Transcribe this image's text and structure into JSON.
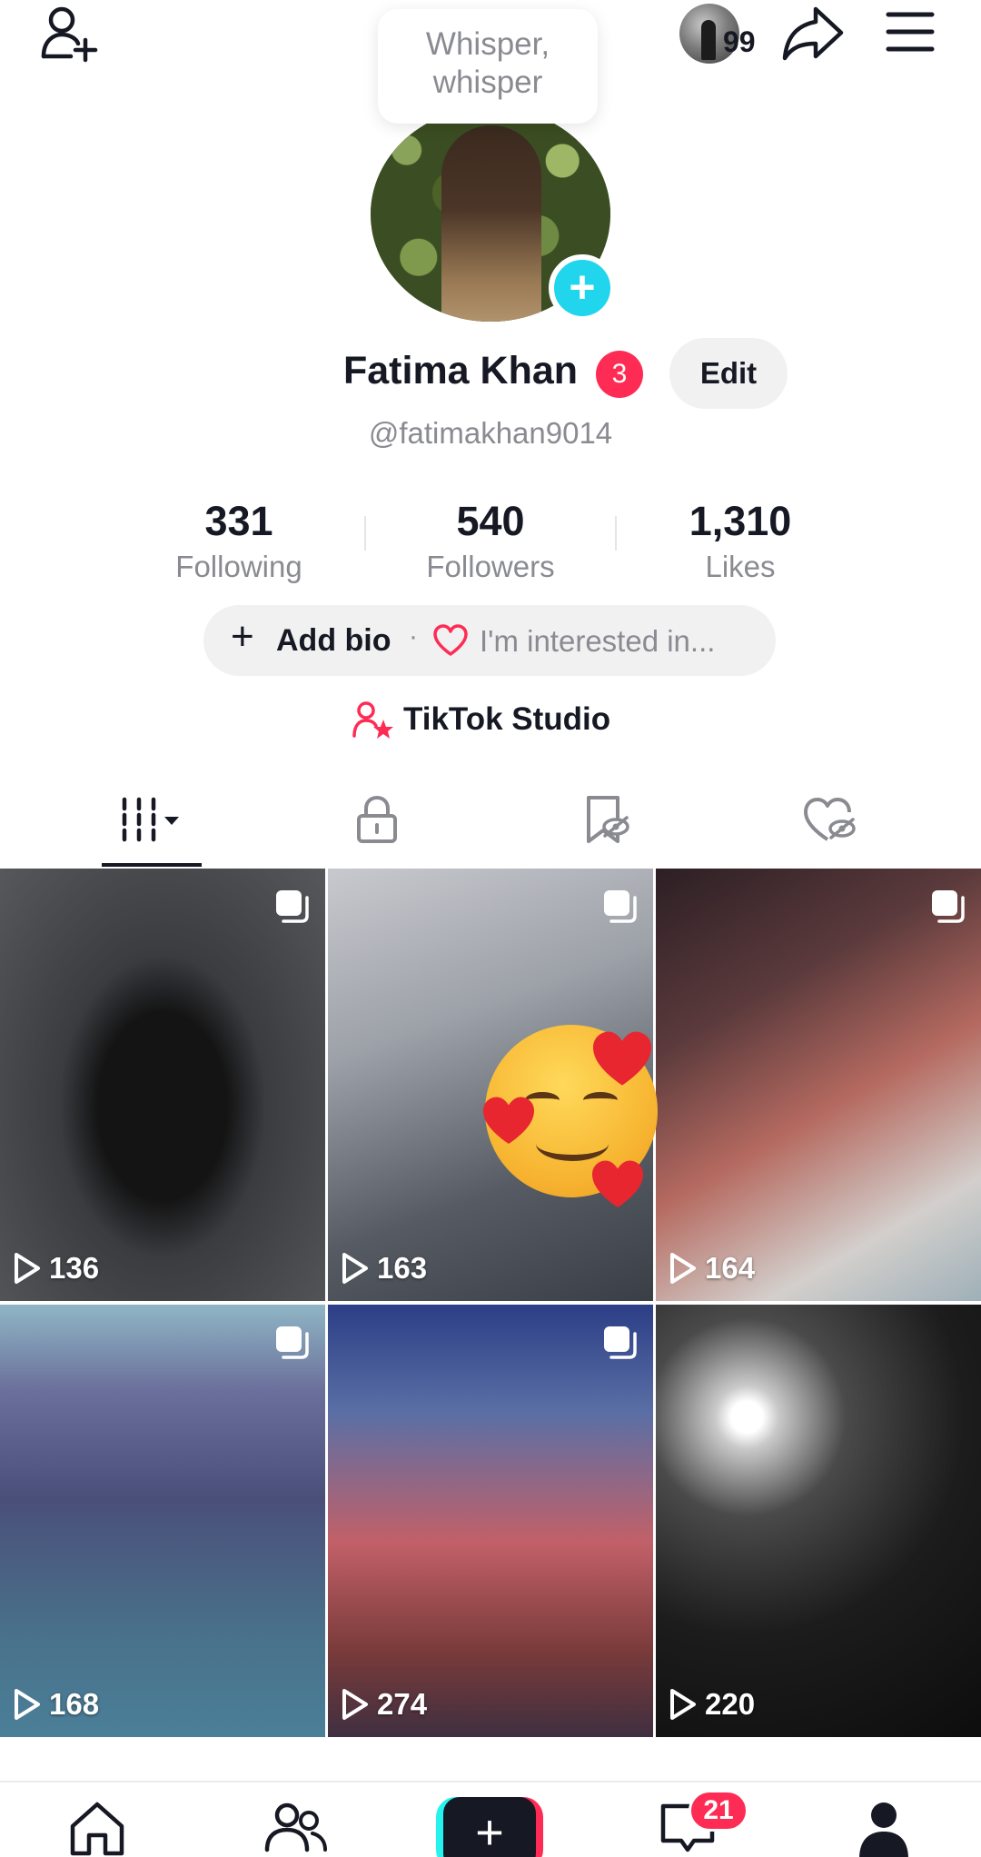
{
  "header": {
    "tooltip_line1": "Whisper,",
    "tooltip_line2": "whisper",
    "story_count": "99"
  },
  "profile": {
    "name": "Fatima Khan",
    "name_badge": "3",
    "edit_label": "Edit",
    "handle": "@fatimakhan9014",
    "avatar_plus": "+"
  },
  "stats": [
    {
      "value": "331",
      "label": "Following"
    },
    {
      "value": "540",
      "label": "Followers"
    },
    {
      "value": "1,310",
      "label": "Likes"
    }
  ],
  "bio": {
    "plus": "+",
    "add_label": "Add bio",
    "separator": "·",
    "interest_label": "I'm interested in..."
  },
  "studio": {
    "label": "TikTok Studio"
  },
  "tabs": [
    "videos-grid-icon",
    "lock-icon",
    "bookmark-hidden-icon",
    "liked-hidden-icon"
  ],
  "videos": [
    {
      "views": "136"
    },
    {
      "views": "163"
    },
    {
      "views": "164"
    },
    {
      "views": "168"
    },
    {
      "views": "274"
    },
    {
      "views": "220"
    }
  ],
  "bottom_nav": {
    "create_label": "+",
    "inbox_badge": "21"
  },
  "colors": {
    "accent_pink": "#fe2c55",
    "accent_cyan": "#20d5ec",
    "text_primary": "#161823",
    "text_secondary": "#8a8b91"
  }
}
